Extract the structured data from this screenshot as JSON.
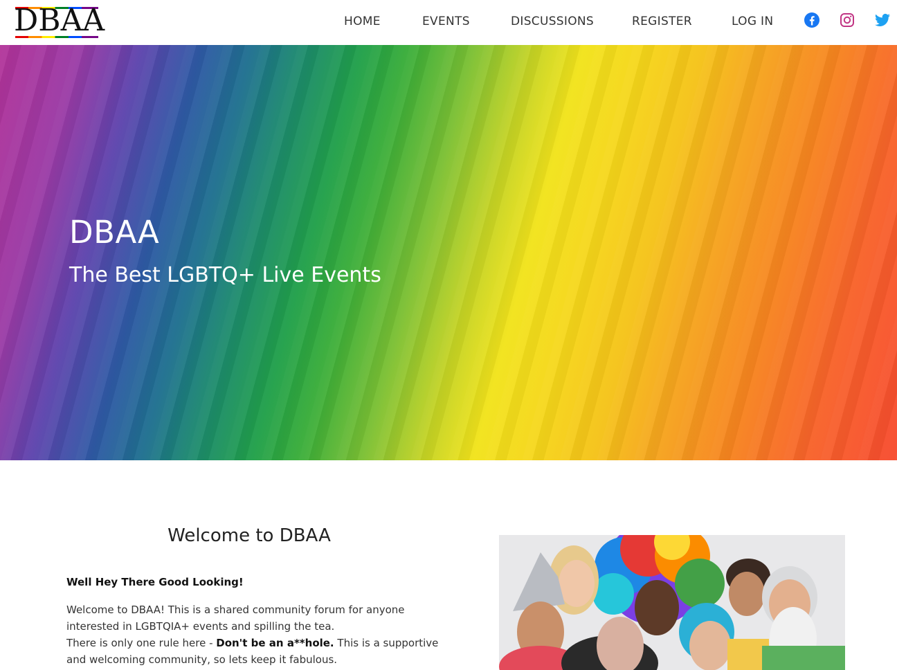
{
  "header": {
    "logo_text": "DBAA",
    "nav": {
      "home": "HOME",
      "events": "EVENTS",
      "discussions": "DISCUSSIONS",
      "register": "REGISTER",
      "login": "LOG IN"
    },
    "social_icons": [
      "facebook-icon",
      "instagram-icon",
      "twitter-icon"
    ]
  },
  "hero": {
    "title": "DBAA",
    "subtitle": "The Best LGBTQ+ Live Events"
  },
  "welcome": {
    "heading": "Welcome to DBAA",
    "greeting": "Well Hey There Good Looking!",
    "line1": "Welcome to DBAA! This is a shared community forum for anyone interested in LGBTQIA+ events and spilling the tea.",
    "line2_start": "There is only one rule here - ",
    "line2_bold": "Don't be an a**hole.",
    "line2_end": " This is a supportive and welcoming community, so lets keep it fabulous."
  },
  "colors": {
    "facebook": "#1877f2",
    "instagram": "#c13584",
    "twitter": "#1da1f2",
    "nav_text": "#333333"
  }
}
